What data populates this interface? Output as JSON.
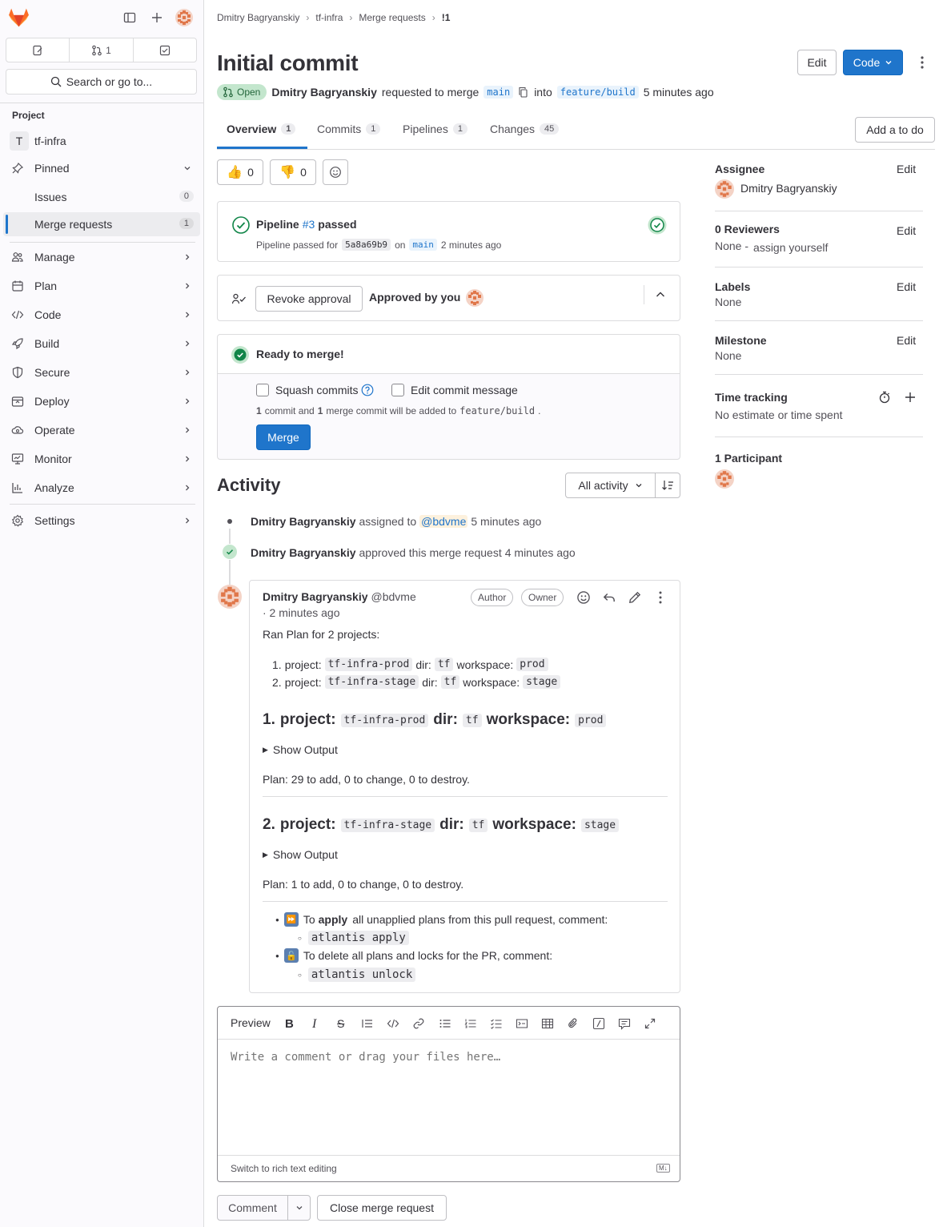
{
  "sidebar": {
    "tabs": [
      {
        "icon": "issues-icon",
        "count": ""
      },
      {
        "icon": "merge-request-icon",
        "count": "1"
      },
      {
        "icon": "todo-icon",
        "count": ""
      }
    ],
    "search_label": "Search or go to...",
    "section_title": "Project",
    "project_initial": "T",
    "project_name": "tf-infra",
    "pinned_label": "Pinned",
    "pinned_items": [
      {
        "label": "Issues",
        "count": "0"
      },
      {
        "label": "Merge requests",
        "count": "1"
      }
    ],
    "nav_items": [
      {
        "label": "Manage",
        "icon": "users-icon"
      },
      {
        "label": "Plan",
        "icon": "calendar-icon"
      },
      {
        "label": "Code",
        "icon": "code-icon"
      },
      {
        "label": "Build",
        "icon": "rocket-icon"
      },
      {
        "label": "Secure",
        "icon": "shield-icon"
      },
      {
        "label": "Deploy",
        "icon": "deploy-icon"
      },
      {
        "label": "Operate",
        "icon": "cloud-gear-icon"
      },
      {
        "label": "Monitor",
        "icon": "monitor-icon"
      },
      {
        "label": "Analyze",
        "icon": "chart-icon"
      }
    ],
    "settings_label": "Settings"
  },
  "breadcrumbs": [
    "Dmitry Bagryanskiy",
    "tf-infra",
    "Merge requests",
    "!1"
  ],
  "mr": {
    "title": "Initial commit",
    "edit_label": "Edit",
    "code_label": "Code",
    "status": "Open",
    "author": "Dmitry Bagryanskiy",
    "requested_text": "requested to merge",
    "source_branch": "main",
    "into_text": "into",
    "target_branch": "feature/build",
    "time_ago": "5 minutes ago"
  },
  "tabs": [
    {
      "label": "Overview",
      "count": "1"
    },
    {
      "label": "Commits",
      "count": "1"
    },
    {
      "label": "Pipelines",
      "count": "1"
    },
    {
      "label": "Changes",
      "count": "45"
    }
  ],
  "add_todo_label": "Add a to do",
  "reactions": {
    "thumbs_up": "0",
    "thumbs_down": "0"
  },
  "pipeline": {
    "prefix": "Pipeline",
    "id": "#3",
    "status": "passed",
    "passed_for": "Pipeline passed for",
    "commit": "5a8a69b9",
    "on": "on",
    "branch": "main",
    "time": "2 minutes ago"
  },
  "approval": {
    "revoke_label": "Revoke approval",
    "approved_text": "Approved by you"
  },
  "merge": {
    "ready_text": "Ready to merge!",
    "squash_label": "Squash commits",
    "edit_msg_label": "Edit commit message",
    "info_count1": "1",
    "info_text1": "commit and",
    "info_count2": "1",
    "info_text2": "merge commit will be added to",
    "info_branch": "feature/build",
    "merge_label": "Merge"
  },
  "activity": {
    "title": "Activity",
    "filter_label": "All activity",
    "events": [
      {
        "author": "Dmitry Bagryanskiy",
        "text": "assigned to",
        "mention": "@bdvme",
        "time": "5 minutes ago"
      },
      {
        "author": "Dmitry Bagryanskiy",
        "text": "approved this merge request",
        "time": "4 minutes ago"
      }
    ]
  },
  "comment": {
    "author": "Dmitry Bagryanskiy",
    "handle": "@bdvme",
    "time": "· 2 minutes ago",
    "badge_author": "Author",
    "badge_owner": "Owner",
    "intro": "Ran Plan for 2 projects:",
    "list": [
      {
        "n": "1.",
        "project": "tf-infra-prod",
        "dir": "tf",
        "workspace": "prod"
      },
      {
        "n": "2.",
        "project": "tf-infra-stage",
        "dir": "tf",
        "workspace": "stage"
      }
    ],
    "project_label": "project:",
    "dir_label": "dir:",
    "workspace_label": "workspace:",
    "heading1_n": "1.",
    "heading2_n": "2.",
    "show_output": "Show Output",
    "plan1": "Plan: 29 to add, 0 to change, 0 to destroy.",
    "plan2": "Plan: 1 to add, 0 to change, 0 to destroy.",
    "apply_pre": "To",
    "apply_bold": "apply",
    "apply_post": "all unapplied plans from this pull request, comment:",
    "apply_cmd": "atlantis apply",
    "unlock_text": "To delete all plans and locks for the PR, comment:",
    "unlock_cmd": "atlantis unlock"
  },
  "editor": {
    "preview_label": "Preview",
    "placeholder": "Write a comment or drag your files here…",
    "switch_label": "Switch to rich text editing",
    "md_label": "M↓"
  },
  "footer": {
    "comment_label": "Comment",
    "close_label": "Close merge request"
  },
  "right": {
    "assignee_title": "Assignee",
    "assignee_name": "Dmitry Bagryanskiy",
    "reviewers_title": "0 Reviewers",
    "reviewers_none": "None -",
    "assign_yourself": "assign yourself",
    "labels_title": "Labels",
    "labels_val": "None",
    "milestone_title": "Milestone",
    "milestone_val": "None",
    "time_title": "Time tracking",
    "time_val": "No estimate or time spent",
    "participants_title": "1 Participant",
    "edit_label": "Edit"
  },
  "colors": {
    "accent": "#1f75cb",
    "success": "#108548",
    "success_bg": "#c3e6cd"
  }
}
